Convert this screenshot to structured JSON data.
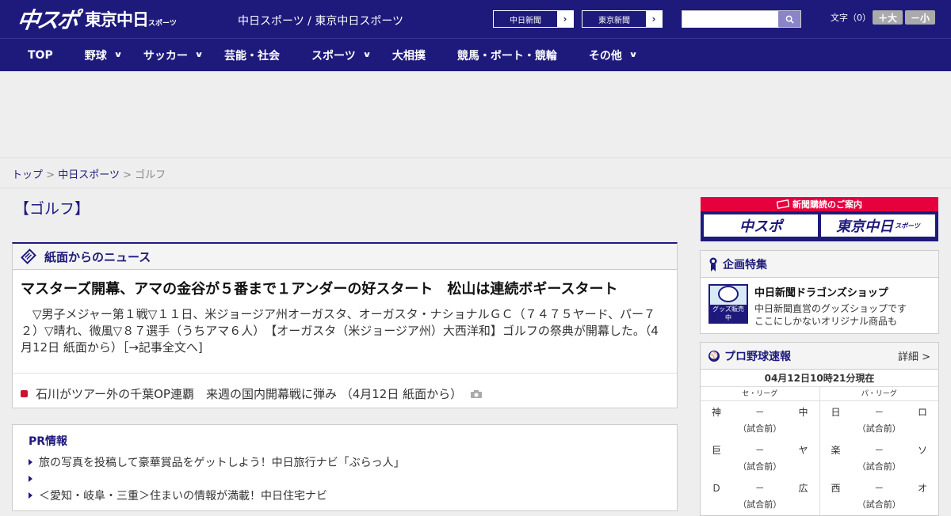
{
  "header": {
    "logo_main": "中スポ",
    "logo_tokyo": "東京中日",
    "logo_tokyo_sub": "スポーツ",
    "site_title": "中日スポーツ / 東京中日スポーツ",
    "paper_links": [
      "中日新聞",
      "東京新聞"
    ],
    "search_placeholder": "",
    "font_size_label": "文字（0）",
    "font_larger": "＋大",
    "font_smaller": "－小"
  },
  "nav": {
    "items": [
      {
        "label": "TOP",
        "has_menu": false
      },
      {
        "label": "野球",
        "has_menu": true
      },
      {
        "label": "サッカー",
        "has_menu": true
      },
      {
        "label": "芸能・社会",
        "has_menu": false
      },
      {
        "label": "スポーツ",
        "has_menu": true
      },
      {
        "label": "大相撲",
        "has_menu": false
      },
      {
        "label": "競馬・ボート・競輪",
        "has_menu": false
      },
      {
        "label": "その他",
        "has_menu": true
      }
    ]
  },
  "breadcrumb": {
    "home": "トップ",
    "section": "中日スポーツ",
    "current": "ゴルフ",
    "separator": ">"
  },
  "page": {
    "title": "【ゴルフ】"
  },
  "news": {
    "section_label": "紙面からのニュース",
    "headline": "マスターズ開幕、アマの金谷が５番まで１アンダーの好スタート　松山は連続ボギースタート",
    "body": "▽男子メジャー第１戦▽１１日、米ジョージア州オーガスタ、オーガスタ・ナショナルＧＣ（７４７５ヤード、パー７２）▽晴れ、微風▽８７選手（うちアマ６人）　【オーガスタ（米ジョージア州）大西洋和】ゴルフの祭典が開幕した。（4月12日 紙面から）［→記事全文へ]",
    "related": "石川がツアー外の千葉OP連覇　来週の国内開幕戦に弾み （4月12日 紙面から）"
  },
  "pr": {
    "title": "PR情報",
    "items": [
      "旅の写真を投稿して豪華賞品をゲットしよう！中日旅行ナビ「ぶらっ人」",
      "",
      "＜愛知・岐阜・三重＞住まいの情報が満載！中日住宅ナビ"
    ]
  },
  "sidebar": {
    "subscription": {
      "title": "新聞購読のご案内",
      "logo_left": "中スポ",
      "logo_right": "東京中日",
      "logo_right_sub": "スポーツ"
    },
    "feature": {
      "section_label": "企画特集",
      "image_label": "グッズ販売中",
      "title": "中日新聞ドラゴンズショップ",
      "desc_line1": "中日新聞直営のグッズショップです",
      "desc_line2": "ここにしかないオリジナル商品も"
    },
    "scores": {
      "section_label": "プロ野球速報",
      "detail_link": "詳細 >",
      "timestamp": "04月12日10時21分現在",
      "central_label": "セ・リーグ",
      "pacific_label": "パ・リーグ",
      "central_games": [
        {
          "home": "神",
          "score": "－",
          "away": "中",
          "status": "（試合前）"
        },
        {
          "home": "巨",
          "score": "－",
          "away": "ヤ",
          "status": "（試合前）"
        },
        {
          "home": "Ｄ",
          "score": "－",
          "away": "広",
          "status": "（試合前）"
        }
      ],
      "pacific_games": [
        {
          "home": "日",
          "score": "－",
          "away": "ロ",
          "status": "（試合前）"
        },
        {
          "home": "楽",
          "score": "－",
          "away": "ソ",
          "status": "（試合前）"
        },
        {
          "home": "西",
          "score": "－",
          "away": "オ",
          "status": "（試合前）"
        }
      ]
    }
  },
  "colors": {
    "brand": "#1e1a7c",
    "accent_red": "#d20f2e"
  }
}
